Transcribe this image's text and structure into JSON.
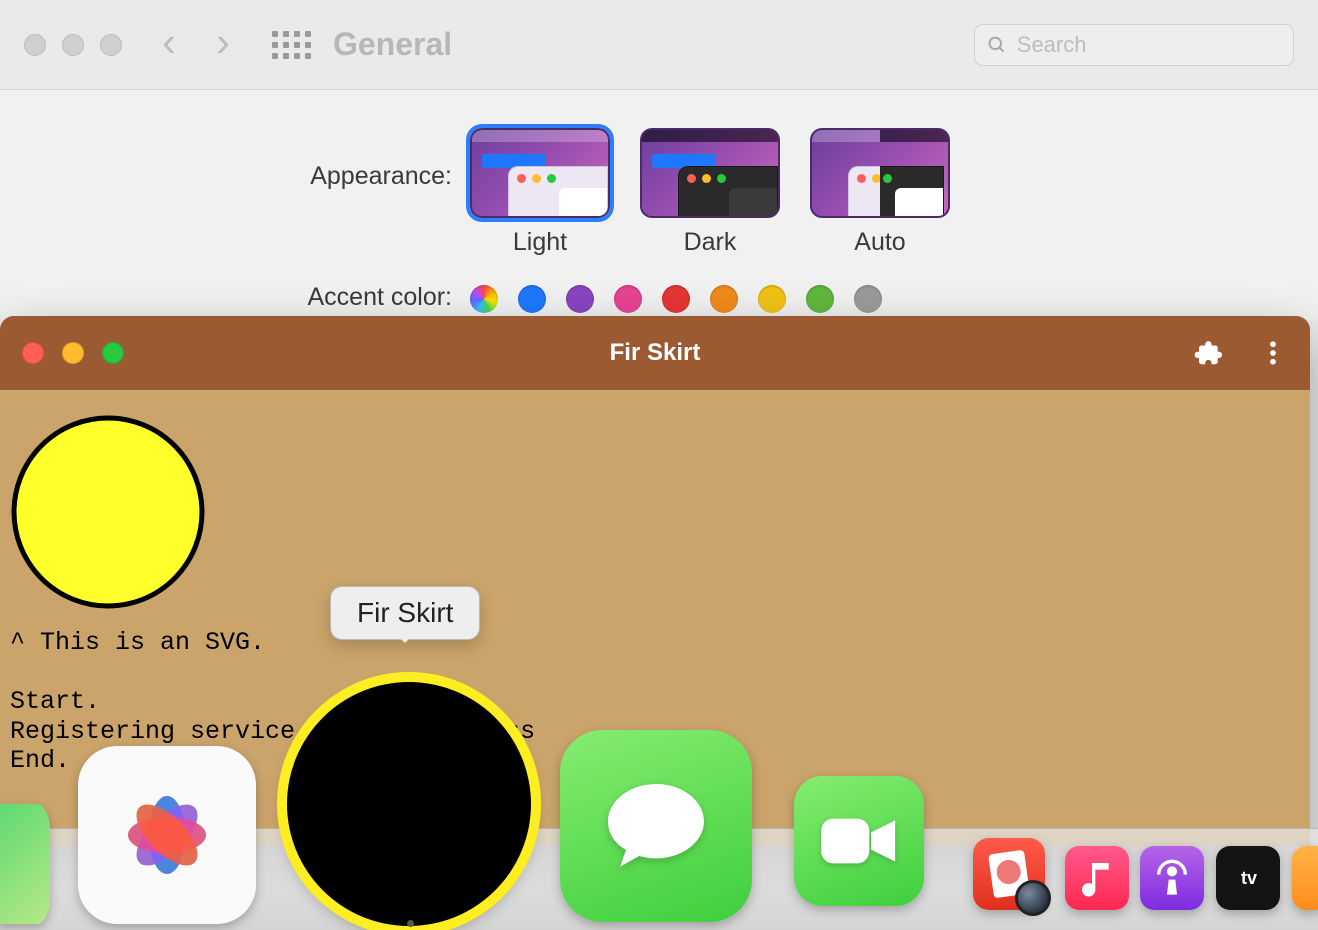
{
  "sysprefs": {
    "title": "General",
    "search_placeholder": "Search",
    "appearance_label": "Appearance:",
    "appearance_options": {
      "light": "Light",
      "dark": "Dark",
      "auto": "Auto"
    },
    "accent_label": "Accent color:",
    "accent_colors": [
      "multicolor",
      "#1d78ff",
      "#8a44c2",
      "#e84393",
      "#e63535",
      "#f08b1d",
      "#f2c314",
      "#5fb83f",
      "#9b9b9b"
    ]
  },
  "firskirt": {
    "title": "Fir Skirt",
    "svg_caption": "^ This is an SVG.",
    "lines": "Start.\nRegistering service            cess\nEnd.",
    "circle_fill": "#ffff2a"
  },
  "dock": {
    "tooltip": "Fir Skirt",
    "tv_label": "tv"
  }
}
